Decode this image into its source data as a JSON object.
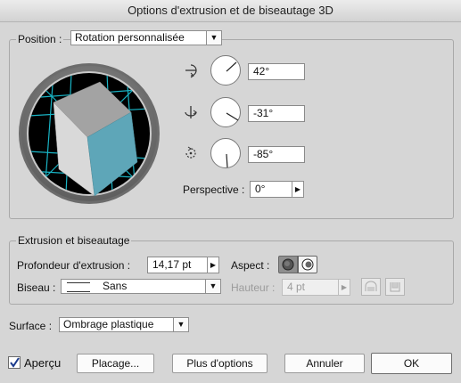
{
  "window": {
    "title": "Options d'extrusion et de biseautage 3D"
  },
  "position": {
    "label": "Position :",
    "preset": "Rotation personnalisée",
    "x_angle": "42°",
    "y_angle": "-31°",
    "z_angle": "-85°",
    "perspective_label": "Perspective :",
    "perspective": "0°"
  },
  "cube": {
    "top_color": "#a3a3a3",
    "left_color": "#d9d9d9",
    "right_color": "#5ea6b8",
    "grid_color": "#19b4c5"
  },
  "extrusion": {
    "section_title": "Extrusion et biseautage",
    "depth_label": "Profondeur d'extrusion :",
    "depth": "14,17 pt",
    "aspect_label": "Aspect :",
    "bevel_label": "Biseau :",
    "bevel": "Sans",
    "height_label": "Hauteur :",
    "height": "4 pt"
  },
  "surface": {
    "label": "Surface :",
    "value": "Ombrage plastique"
  },
  "footer": {
    "preview_label": "Aperçu",
    "preview_checked": true,
    "placement": "Placage...",
    "more_options": "Plus d'options",
    "cancel": "Annuler",
    "ok": "OK"
  }
}
